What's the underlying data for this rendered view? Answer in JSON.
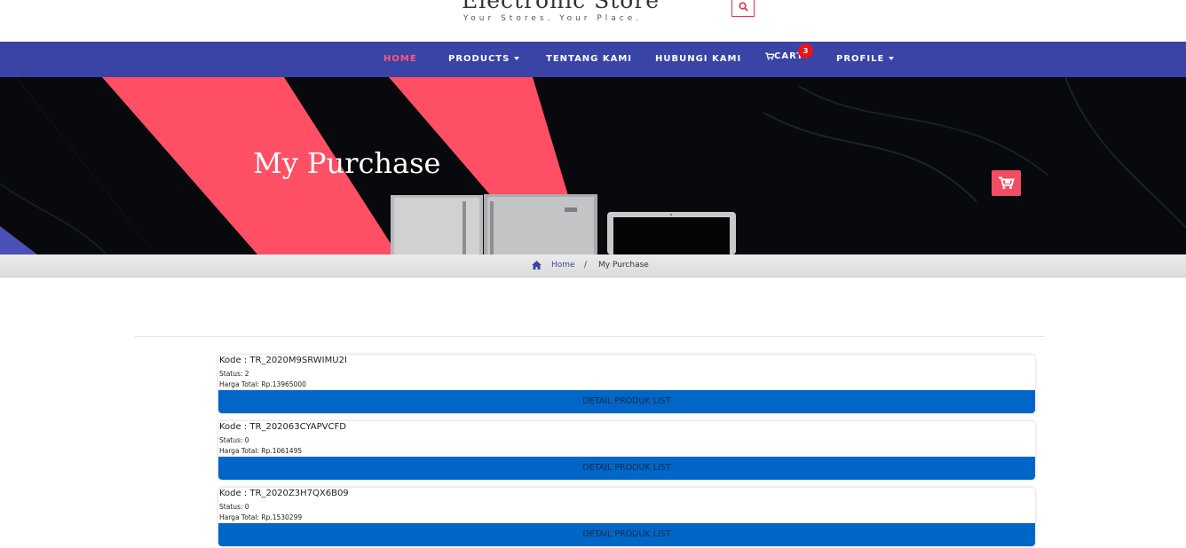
{
  "header": {
    "title": "Electronic Store",
    "tagline": "Your Stores. Your Place."
  },
  "nav": {
    "items": [
      {
        "label": "HOME"
      },
      {
        "label": "PRODUCTS"
      },
      {
        "label": "TENTANG KAMI"
      },
      {
        "label": "HUBUNGI KAMI"
      },
      {
        "label": "CART"
      },
      {
        "label": "PROFILE"
      }
    ],
    "cart_count": "3"
  },
  "banner": {
    "title": "My Purchase"
  },
  "breadcrumb": {
    "home": "Home",
    "separator": "/",
    "current": "My Purchase"
  },
  "purchases": [
    {
      "code": "Kode : TR_2020M9SRWIMU2I",
      "status": "Status: 2",
      "price": "Harga Total: Rp.13965000",
      "button": "DETAIL PRODUK LIST"
    },
    {
      "code": "Kode : TR_202063CYAPVCFD",
      "status": "Status: 0",
      "price": "Harga Total: Rp.1061495",
      "button": "DETAIL PRODUK LIST"
    },
    {
      "code": "Kode : TR_2020Z3H7QX6B09",
      "status": "Status: 0",
      "price": "Harga Total: Rp.1530299",
      "button": "DETAIL PRODUK LIST"
    }
  ],
  "colors": {
    "nav_bg": "#3a43a6",
    "accent": "#ff5b73",
    "button_blue": "#0066c7",
    "badge_red": "#e8131d"
  },
  "icons": [
    "search-icon",
    "cart-icon",
    "home-icon",
    "chevron-down-icon"
  ]
}
